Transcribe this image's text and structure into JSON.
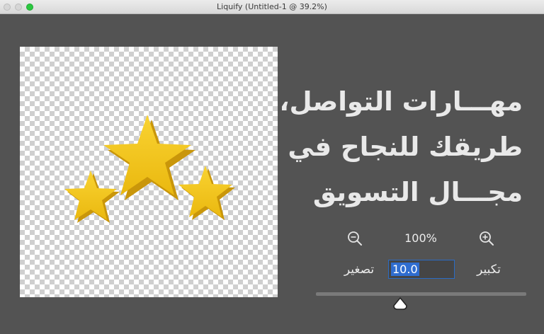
{
  "window": {
    "title": "Liquify (Untitled-1 @ 39.2%)"
  },
  "canvas": {
    "background": "transparent-checkerboard",
    "image": "three-gold-stars",
    "star_color": "#f2c318"
  },
  "heading": {
    "line1": "مهـــارات التواصل،",
    "line2": "طريقك للنجاح في",
    "line3": "مجـــال التسويق"
  },
  "controls": {
    "zoom_out_icon": "zoom-out-icon",
    "zoom_in_icon": "zoom-in-icon",
    "zoom_level": "100%",
    "shrink_label": "تصغير",
    "enlarge_label": "تكبير",
    "brush_size_value": "10.0",
    "slider_position": 0.4,
    "accent_color": "#2f6dd0"
  }
}
